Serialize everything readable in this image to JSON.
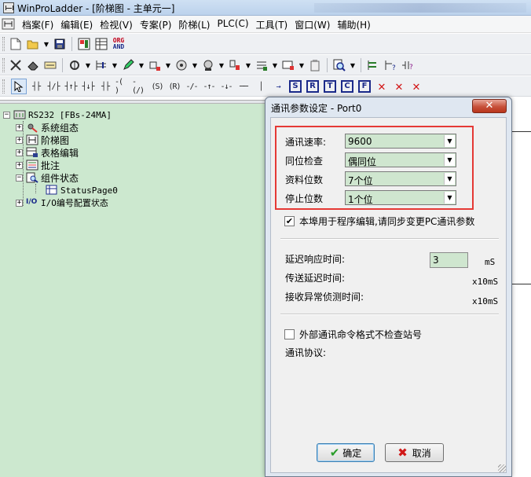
{
  "window": {
    "title": "WinProLadder - [阶梯图 - 主单元一]"
  },
  "menubar": {
    "items": [
      "档案(F)",
      "编辑(E)",
      "检视(V)",
      "专案(P)",
      "阶梯(L)",
      "PLC(C)",
      "工具(T)",
      "窗口(W)",
      "辅助(H)"
    ]
  },
  "toolbar1": {
    "org_and_top": "ORG",
    "org_and_bottom": "AND"
  },
  "toolbar3": {
    "letter_buttons": [
      "S",
      "R",
      "T",
      "C",
      "F"
    ]
  },
  "tree": {
    "root": "RS232 [FBs-24MA]",
    "items": [
      "系统组态",
      "阶梯图",
      "表格编辑",
      "批注",
      "组件状态"
    ],
    "child": "StatusPage0",
    "io_item": "I/O编号配置状态",
    "io_icon_text": "I/O"
  },
  "dialog": {
    "title": "通讯参数设定 - Port0",
    "close_glyph": "✕",
    "fields": {
      "baud": {
        "label": "通讯速率:",
        "value": "9600"
      },
      "parity": {
        "label": "同位检查",
        "value": "偶同位"
      },
      "data_bits": {
        "label": "资料位数",
        "value": "7个位"
      },
      "stop_bits": {
        "label": "停止位数",
        "value": "1个位"
      }
    },
    "sync_checkbox": {
      "checked": true,
      "label": "本埠用于程序编辑,请同步变更PC通讯参数"
    },
    "delay_response": {
      "label": "延迟响应时间:",
      "value": "3",
      "unit": "mS"
    },
    "send_delay": {
      "label": "传送延迟时间:",
      "unit": "x10mS"
    },
    "recv_timeout": {
      "label": "接收异常侦测时间:",
      "unit": "x10mS"
    },
    "no_station_check": {
      "checked": false,
      "label": "外部通讯命令格式不检查站号"
    },
    "protocol": {
      "label": "通讯协议:"
    },
    "ok_label": "确定",
    "cancel_label": "取消"
  }
}
